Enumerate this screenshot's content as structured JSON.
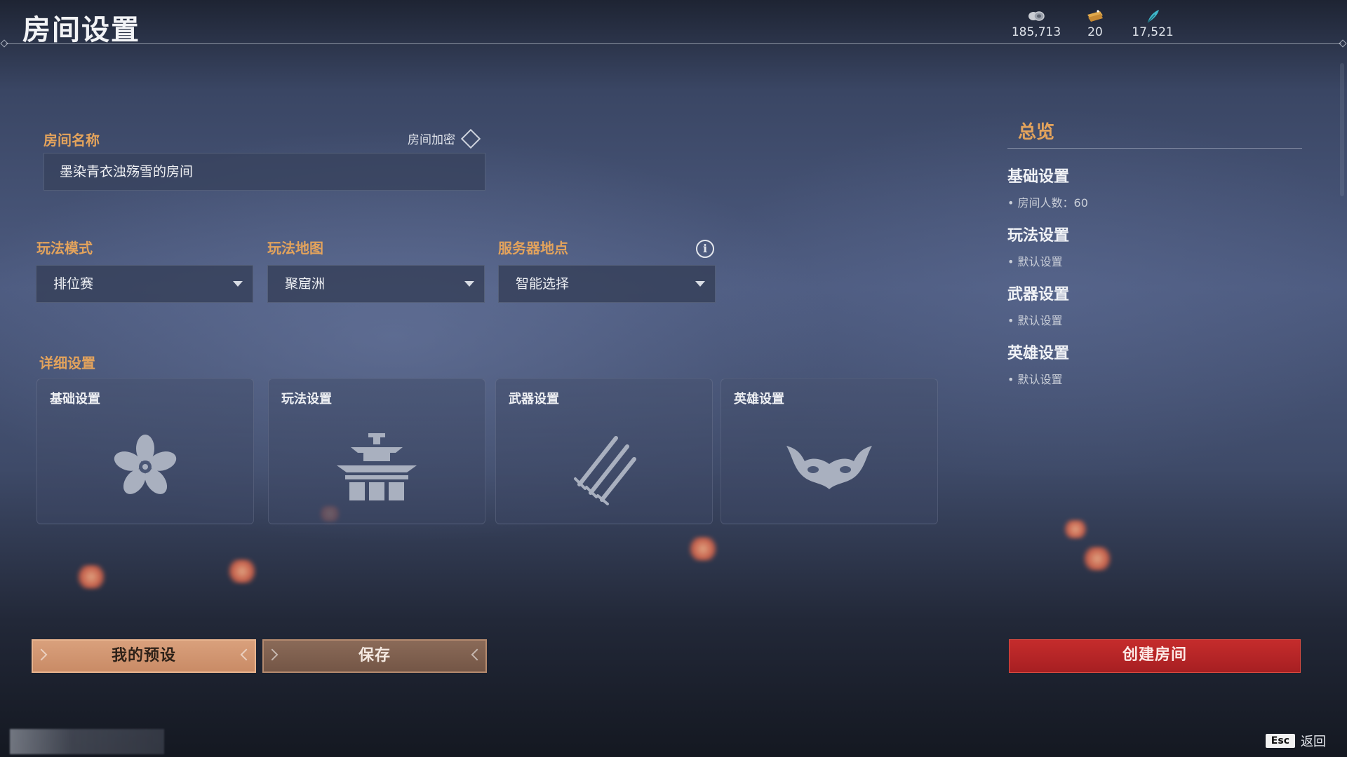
{
  "header": {
    "title": "房间设置",
    "currencies": [
      {
        "icon": "coin-stack-icon",
        "value": "185,713"
      },
      {
        "icon": "ticket-icon",
        "value": "20"
      },
      {
        "icon": "feather-icon",
        "value": "17,521"
      }
    ]
  },
  "room": {
    "name_label": "房间名称",
    "name_value": "墨染青衣浊殇雪的房间",
    "lock_label": "房间加密"
  },
  "selectors": [
    {
      "label": "玩法模式",
      "value": "排位赛"
    },
    {
      "label": "玩法地图",
      "value": "聚窟洲"
    },
    {
      "label": "服务器地点",
      "value": "智能选择"
    }
  ],
  "details": {
    "label": "详细设置",
    "cards": [
      {
        "title": "基础设置",
        "icon": "flower-icon"
      },
      {
        "title": "玩法设置",
        "icon": "pagoda-icon"
      },
      {
        "title": "武器设置",
        "icon": "swords-icon"
      },
      {
        "title": "英雄设置",
        "icon": "horned-mask-icon"
      }
    ]
  },
  "overview": {
    "title": "总览",
    "sections": [
      {
        "heading": "基础设置",
        "item": "• 房间人数：60"
      },
      {
        "heading": "玩法设置",
        "item": "• 默认设置"
      },
      {
        "heading": "武器设置",
        "item": "• 默认设置"
      },
      {
        "heading": "英雄设置",
        "item": "• 默认设置"
      }
    ]
  },
  "buttons": {
    "preset": "我的预设",
    "save": "保存",
    "create": "创建房间"
  },
  "footer": {
    "esc_key": "Esc",
    "back": "返回"
  },
  "colors": {
    "accent": "#e3a35c",
    "create": "#b8262a",
    "preset": "#d29878"
  }
}
